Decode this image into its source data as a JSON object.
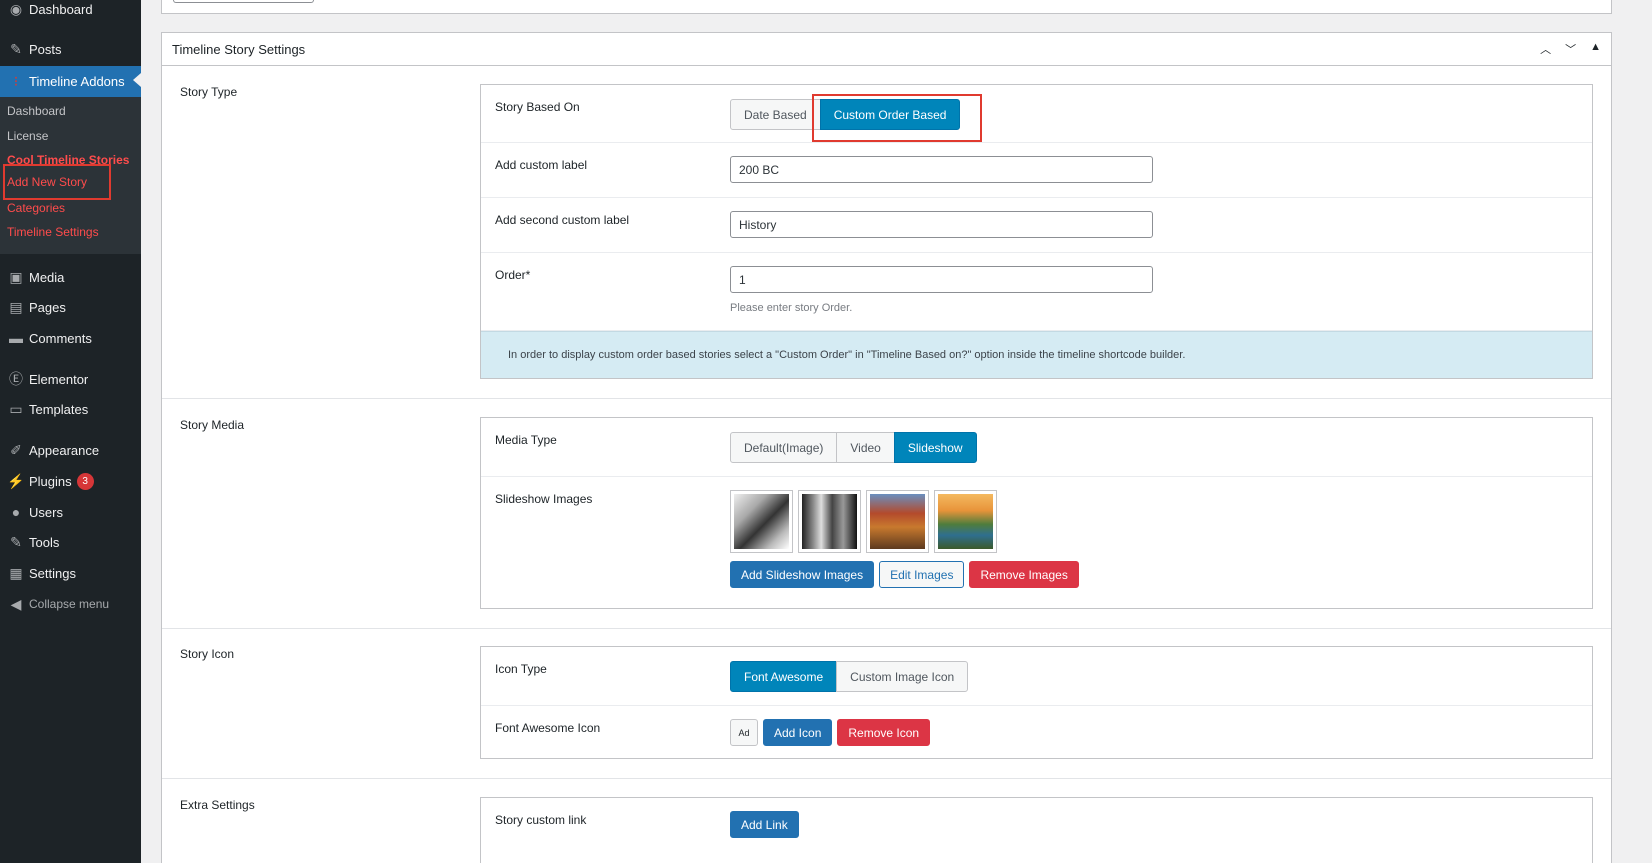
{
  "sidebar": {
    "items": [
      {
        "label": "Dashboard",
        "icon": "dashboard-icon"
      },
      {
        "label": "Posts",
        "icon": "pin-icon"
      },
      {
        "label": "Timeline Addons",
        "icon": "timeline-icon"
      },
      {
        "label": "Media",
        "icon": "media-icon"
      },
      {
        "label": "Pages",
        "icon": "pages-icon"
      },
      {
        "label": "Comments",
        "icon": "comments-icon"
      },
      {
        "label": "Elementor",
        "icon": "elementor-icon"
      },
      {
        "label": "Templates",
        "icon": "folder-icon"
      },
      {
        "label": "Appearance",
        "icon": "brush-icon"
      },
      {
        "label": "Plugins",
        "icon": "plug-icon",
        "badge": "3"
      },
      {
        "label": "Users",
        "icon": "user-icon"
      },
      {
        "label": "Tools",
        "icon": "wrench-icon"
      },
      {
        "label": "Settings",
        "icon": "settings-icon"
      },
      {
        "label": "Collapse menu",
        "icon": "collapse-icon"
      }
    ],
    "submenu": [
      {
        "label": "Dashboard"
      },
      {
        "label": "License"
      },
      {
        "label": "Cool Timeline Stories"
      },
      {
        "label": "Add New Story"
      },
      {
        "label": "Categories"
      },
      {
        "label": "Timeline Settings"
      }
    ]
  },
  "postbox": {
    "title": "Timeline Story Settings"
  },
  "story_type": {
    "section_label": "Story Type",
    "based_on_label": "Story Based On",
    "based_on_options": [
      "Date Based",
      "Custom Order Based"
    ],
    "based_on_selected": "Custom Order Based",
    "custom_label_label": "Add custom label",
    "custom_label_value": "200 BC",
    "second_label_label": "Add second custom label",
    "second_label_value": "History",
    "order_label": "Order*",
    "order_value": "1",
    "order_hint": "Please enter story Order.",
    "notice": "In order to display custom order based stories select a \"Custom Order\" in \"Timeline Based on?\" option inside the timeline shortcode builder."
  },
  "story_media": {
    "section_label": "Story Media",
    "media_type_label": "Media Type",
    "media_type_options": [
      "Default(Image)",
      "Video",
      "Slideshow"
    ],
    "media_type_selected": "Slideshow",
    "slideshow_label": "Slideshow Images",
    "add_button": "Add Slideshow Images",
    "edit_button": "Edit Images",
    "remove_button": "Remove Images"
  },
  "story_icon": {
    "section_label": "Story Icon",
    "icon_type_label": "Icon Type",
    "icon_type_options": [
      "Font Awesome",
      "Custom Image Icon"
    ],
    "icon_type_selected": "Font Awesome",
    "fa_label": "Font Awesome Icon",
    "fa_preview": "Ad",
    "add_icon_button": "Add Icon",
    "remove_icon_button": "Remove Icon"
  },
  "extra": {
    "section_label": "Extra Settings",
    "link_label": "Story custom link",
    "add_link_button": "Add Link"
  },
  "colors": {
    "sidebar_bg": "#1d2327",
    "active_menu": "#2271b1",
    "segment_on": "#0085ba",
    "danger": "#dc3545",
    "highlight": "#e03a2f",
    "notice_bg": "#d5ebf3"
  }
}
